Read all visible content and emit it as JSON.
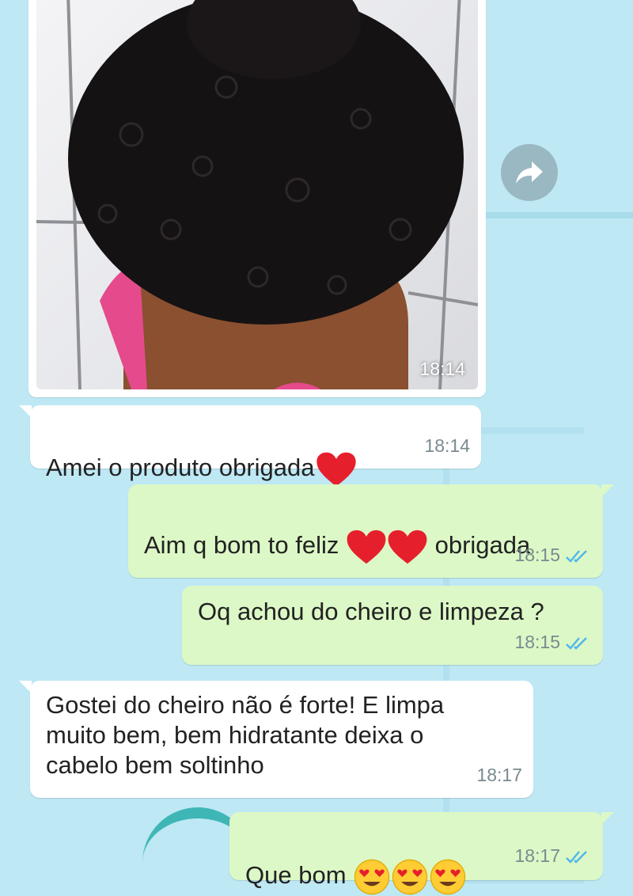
{
  "messages": [
    {
      "id": "m0",
      "direction": "in",
      "type": "photo",
      "time": "18:14"
    },
    {
      "id": "m1",
      "direction": "in",
      "text_before": "Amei o produto obrigada",
      "time": "18:14",
      "emoji": [
        "red-heart"
      ]
    },
    {
      "id": "m2",
      "direction": "out",
      "text_before": "Aim q  bom to feliz ",
      "text_after": " obrigada",
      "time": "18:15",
      "emoji": [
        "red-heart",
        "red-heart"
      ],
      "status": "read"
    },
    {
      "id": "m3",
      "direction": "out",
      "text_before": "Oq achou do cheiro e limpeza ?",
      "time": "18:15",
      "status": "read"
    },
    {
      "id": "m4",
      "direction": "in",
      "text_before": "Gostei do cheiro não é forte! E limpa\nmuito bem, bem hidratante deixa o\ncabelo bem soltinho",
      "time": "18:17"
    },
    {
      "id": "m5",
      "direction": "out",
      "text_before": "Que bom ",
      "time": "18:17",
      "emoji": [
        "heart-eyes-face",
        "heart-eyes-face",
        "heart-eyes-face"
      ],
      "status": "read"
    }
  ],
  "colors": {
    "wallpaper": "#bde8f4",
    "incoming_bubble": "#ffffff",
    "outgoing_bubble": "#dcf8c6",
    "read_ticks": "#4fb6ec",
    "heart": "#e5202c",
    "timestamp": "#7a8a8f"
  },
  "icons": {
    "forward": "forward-arrow-icon",
    "read_status": "double-check-icon"
  }
}
